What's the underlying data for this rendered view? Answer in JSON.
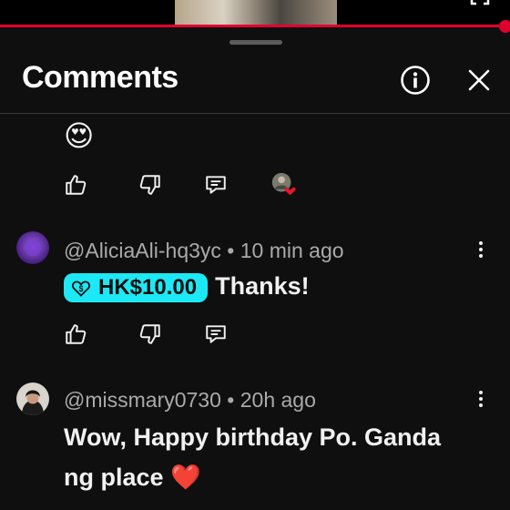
{
  "player": {
    "fullscreen_icon": "fullscreen-icon",
    "progress_color": "#e1002d"
  },
  "header": {
    "title": "Comments",
    "info_icon": "info-icon",
    "close_icon": "close-icon"
  },
  "top_comment": {
    "emoji": "😍",
    "like_icon": "thumbs-up-icon",
    "dislike_icon": "thumbs-down-icon",
    "reply_icon": "reply-icon",
    "creator_heart_icon": "creator-heart-icon"
  },
  "comments": [
    {
      "author": "@AliciaAli-hq3yc",
      "separator": "•",
      "time": "10 min ago",
      "super_chat_amount": "HK$10.00",
      "text": "Thanks!",
      "super_chat_color": "#1de9f6"
    },
    {
      "author": "@missmary0730",
      "separator": "•",
      "time": "20h ago",
      "text_line1": "Wow, Happy birthday Po. Ganda",
      "text_line2": "ng place",
      "emoji": "❤️"
    }
  ]
}
